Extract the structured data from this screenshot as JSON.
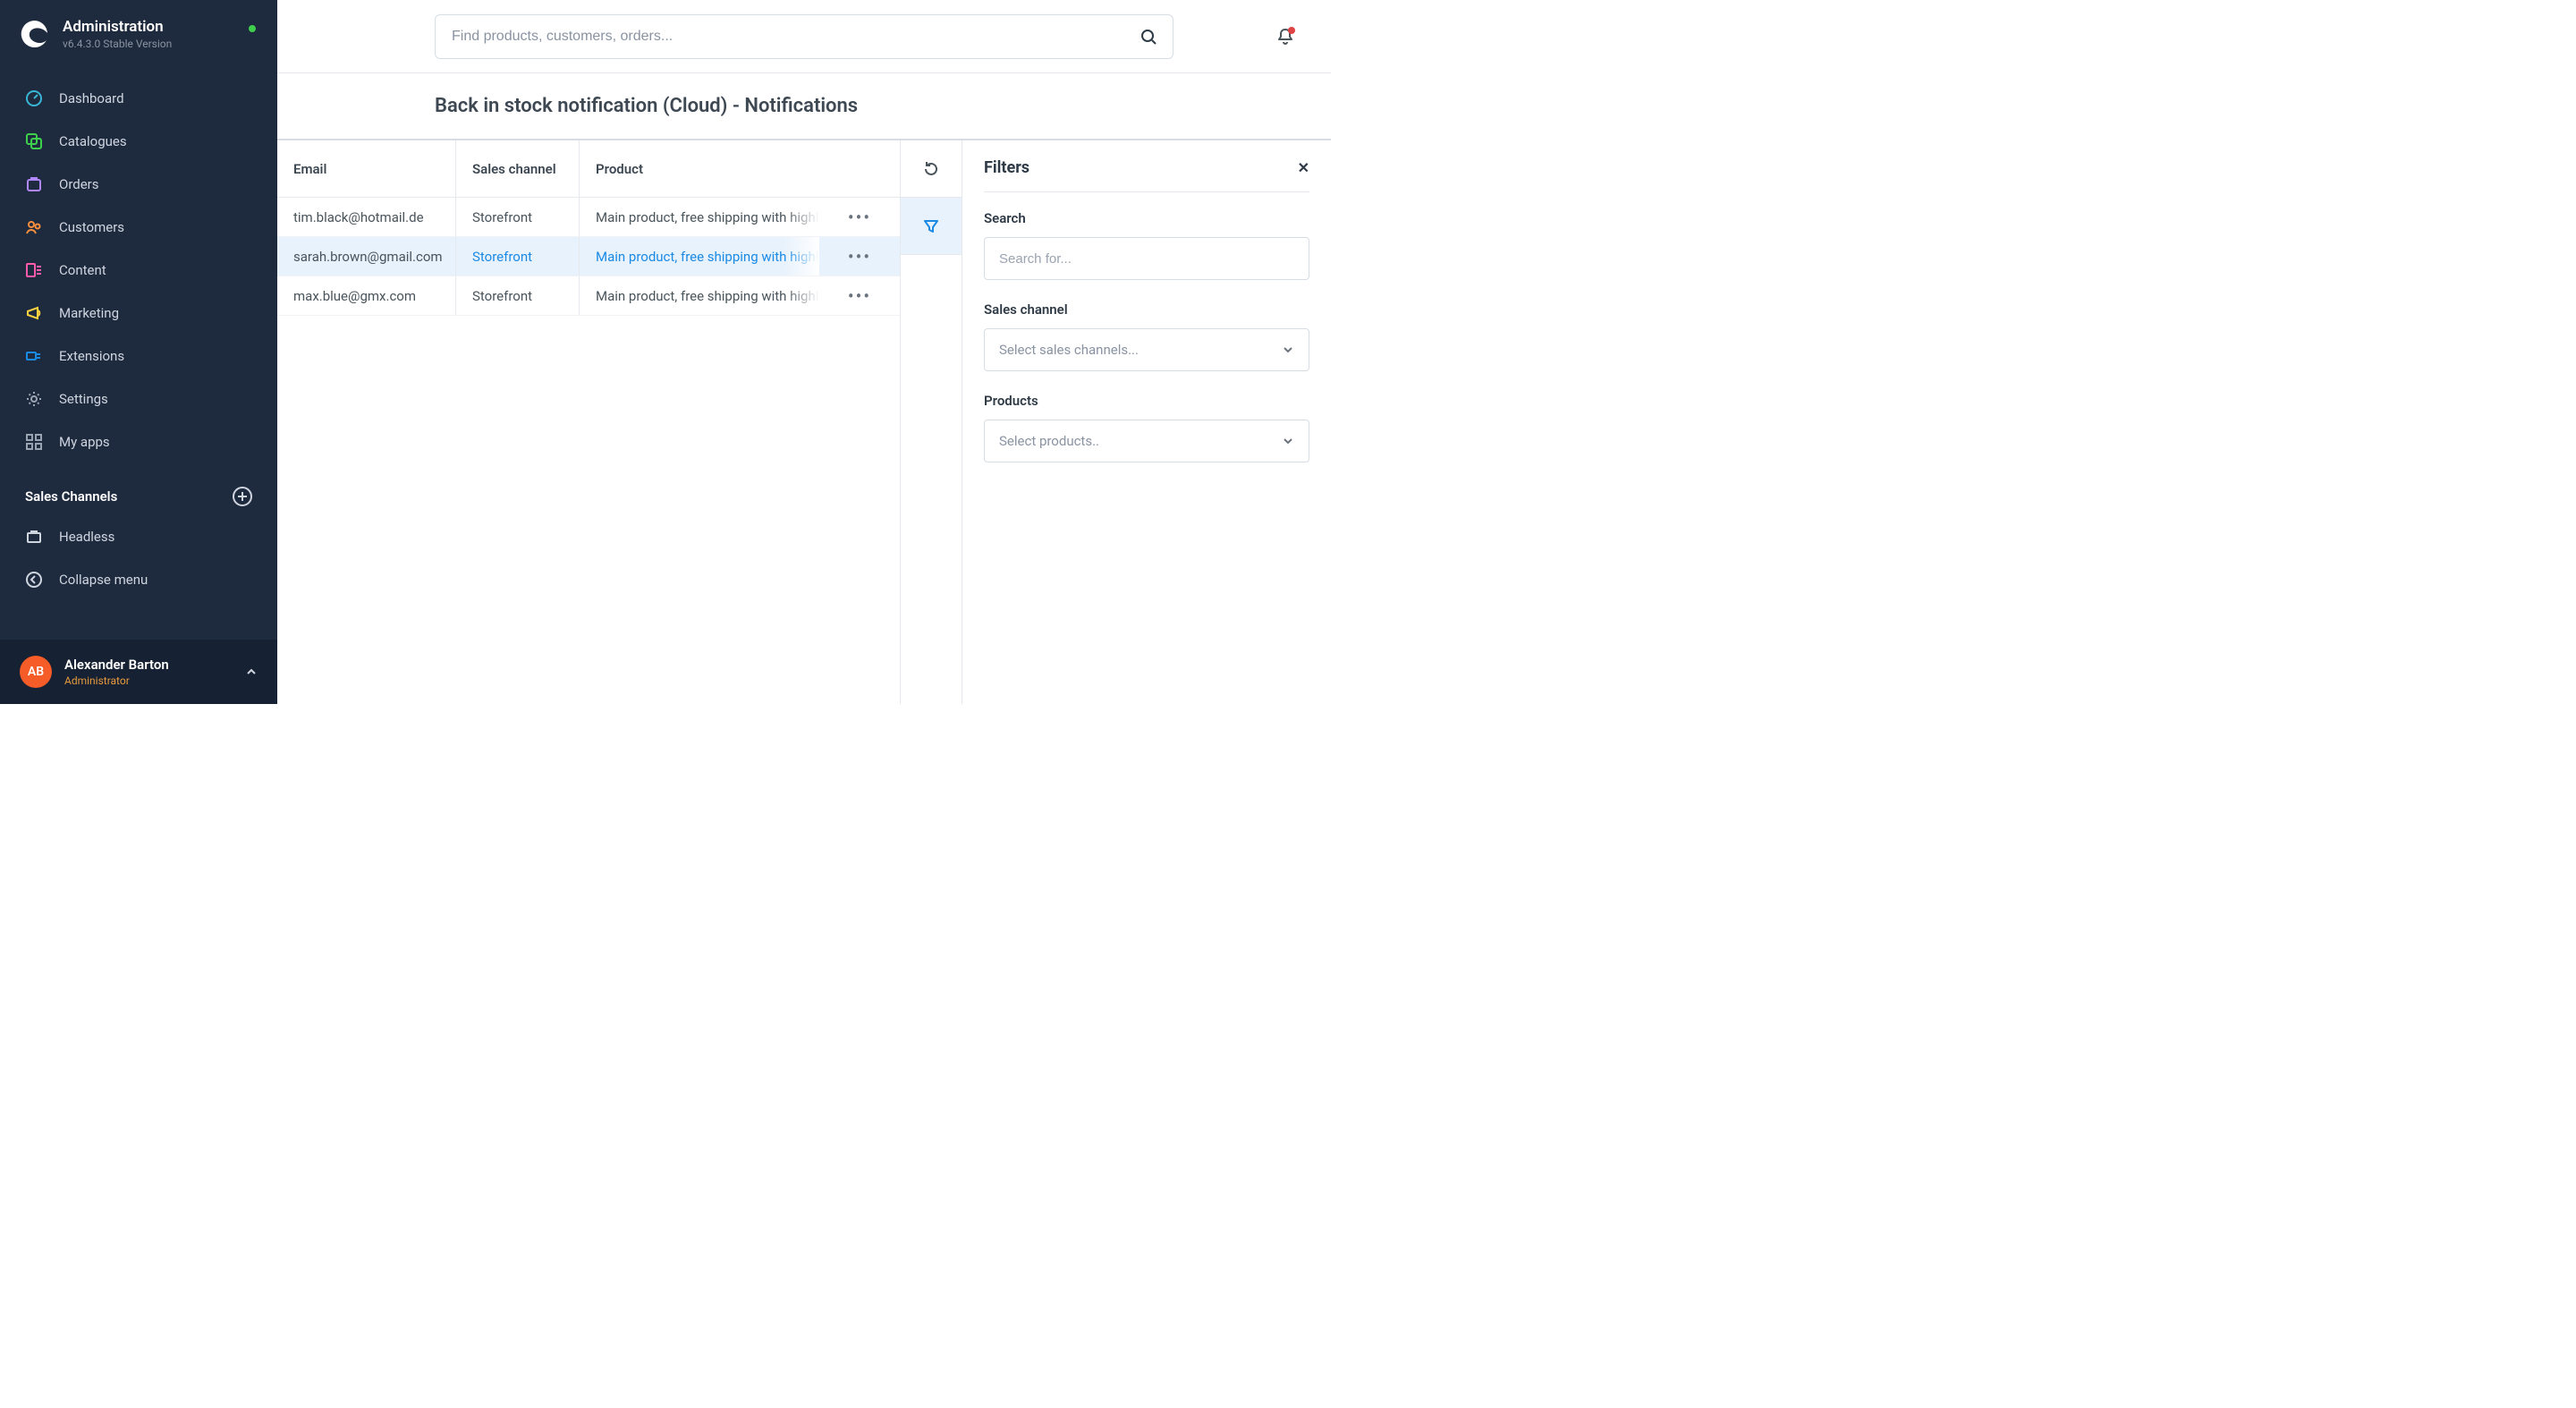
{
  "header": {
    "title": "Administration",
    "version": "v6.4.3.0 Stable Version"
  },
  "nav": {
    "items": [
      {
        "label": "Dashboard",
        "key": "dashboard"
      },
      {
        "label": "Catalogues",
        "key": "catalogues"
      },
      {
        "label": "Orders",
        "key": "orders"
      },
      {
        "label": "Customers",
        "key": "customers"
      },
      {
        "label": "Content",
        "key": "content"
      },
      {
        "label": "Marketing",
        "key": "marketing"
      },
      {
        "label": "Extensions",
        "key": "extensions"
      },
      {
        "label": "Settings",
        "key": "settings"
      },
      {
        "label": "My apps",
        "key": "myapps"
      }
    ],
    "salesChannelsTitle": "Sales Channels",
    "salesChannels": [
      {
        "label": "Headless"
      }
    ],
    "collapse": "Collapse menu"
  },
  "user": {
    "initials": "AB",
    "name": "Alexander Barton",
    "role": "Administrator"
  },
  "search": {
    "placeholder": "Find products, customers, orders..."
  },
  "page": {
    "title": "Back in stock notification (Cloud) - Notifications"
  },
  "table": {
    "headers": {
      "email": "Email",
      "channel": "Sales channel",
      "product": "Product"
    },
    "rows": [
      {
        "email": "tim.black@hotmail.de",
        "channel": "Storefront",
        "product": "Main product, free shipping with highlighted features",
        "active": false
      },
      {
        "email": "sarah.brown@gmail.com",
        "channel": "Storefront",
        "product": "Main product, free shipping with highlighted features",
        "active": true
      },
      {
        "email": "max.blue@gmx.com",
        "channel": "Storefront",
        "product": "Main product, free shipping with highlighted features",
        "active": false
      }
    ]
  },
  "filters": {
    "title": "Filters",
    "searchLabel": "Search",
    "searchPlaceholder": "Search for...",
    "channelLabel": "Sales channel",
    "channelPlaceholder": "Select sales channels...",
    "productsLabel": "Products",
    "productsPlaceholder": "Select products.."
  },
  "icon_colors": {
    "dashboard": "#39b6d4",
    "catalogues": "#3ecf4c",
    "orders": "#b187ff",
    "customers": "#f58f3e",
    "content": "#ff5ba8",
    "marketing": "#ffd23f",
    "extensions": "#1a8ae5",
    "settings": "#9aa3b0",
    "myapps": "#9aa3b0"
  }
}
